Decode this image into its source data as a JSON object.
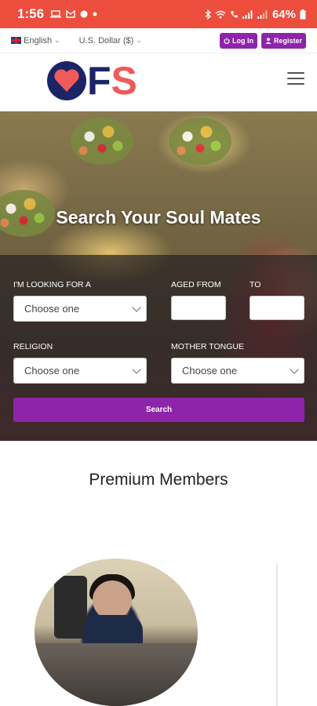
{
  "status_bar": {
    "time": "1:56",
    "battery": "64%"
  },
  "topbar": {
    "language": "English",
    "currency": "U.S. Dollar ($)",
    "login_label": "Log In",
    "register_label": "Register"
  },
  "header": {
    "logo_text_f": "F",
    "logo_text_s": "S"
  },
  "hero": {
    "title": "Search Your Soul Mates"
  },
  "search_form": {
    "looking_for_label": "I'M LOOKING FOR A",
    "looking_for_value": "Choose one",
    "aged_from_label": "AGED FROM",
    "to_label": "TO",
    "aged_from_value": "",
    "to_value": "",
    "religion_label": "RELIGION",
    "religion_value": "Choose one",
    "mother_tongue_label": "MOTHER TONGUE",
    "mother_tongue_value": "Choose one",
    "search_button_label": "Search"
  },
  "premium": {
    "title": "Premium Members"
  },
  "colors": {
    "status_bar": "#ec4d3d",
    "accent_purple": "#8e24aa",
    "logo_navy": "#1b2466",
    "logo_coral": "#ef5a5a"
  }
}
